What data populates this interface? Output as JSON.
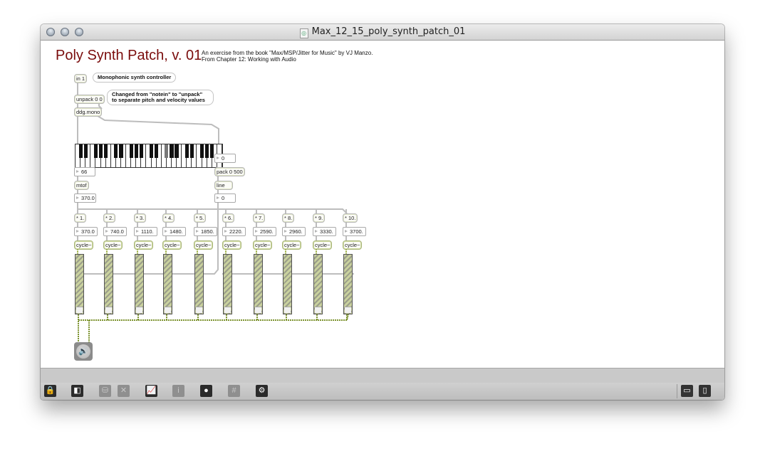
{
  "window": {
    "title": "Max_12_15_poly_synth_patch_01",
    "traffic_lights": [
      "close",
      "minimize",
      "zoom"
    ]
  },
  "patch": {
    "title": "Poly Synth Patch, v. 01",
    "description_line1": "An exercise from the book \"Max/MSP/Jitter for Music\" by VJ Manzo.",
    "description_line2": "From Chapter 12: Working with Audio"
  },
  "objects": {
    "in": "in 1",
    "in_comment": "Monophonic synth controller",
    "unpack": "unpack 0 0",
    "unpack_comment": "Changed from \"notein\" to \"unpack\" to separate pitch and velocity values",
    "ddg": "ddg.mono",
    "pitch_number": "66",
    "mtof": "mtof",
    "freq_number": "370.0",
    "vel_number": "0",
    "pack": "pack 0 500",
    "line": "line",
    "line_number": "0"
  },
  "keyboard": {
    "highlighted_key": "F#",
    "octaves": 5
  },
  "voices": [
    {
      "mult": "* 1.",
      "freq": "370.0",
      "osc": "cycle~"
    },
    {
      "mult": "* 2.",
      "freq": "740.0",
      "osc": "cycle~"
    },
    {
      "mult": "* 3.",
      "freq": "1110.",
      "osc": "cycle~"
    },
    {
      "mult": "* 4.",
      "freq": "1480.",
      "osc": "cycle~"
    },
    {
      "mult": "* 5.",
      "freq": "1850.",
      "osc": "cycle~"
    },
    {
      "mult": "* 6.",
      "freq": "2220.",
      "osc": "cycle~"
    },
    {
      "mult": "* 7.",
      "freq": "2590.",
      "osc": "cycle~"
    },
    {
      "mult": "* 8.",
      "freq": "2960.",
      "osc": "cycle~"
    },
    {
      "mult": "* 9.",
      "freq": "3330.",
      "osc": "cycle~"
    },
    {
      "mult": "* 10.",
      "freq": "3700.",
      "osc": "cycle~"
    }
  ],
  "gain_level": 0,
  "dac": {
    "icon": "speaker-icon"
  },
  "toolbar": {
    "items": [
      {
        "name": "lock",
        "glyph": "🔒",
        "enabled": true
      },
      {
        "name": "presentation",
        "glyph": "◧",
        "enabled": true
      },
      {
        "name": "paint-bucket",
        "glyph": "⛁",
        "enabled": false
      },
      {
        "name": "delete",
        "glyph": "✕",
        "enabled": false
      },
      {
        "name": "presentation-mode",
        "glyph": "📈",
        "enabled": true
      },
      {
        "name": "inspector",
        "glyph": "i",
        "enabled": false
      },
      {
        "name": "patch-cords",
        "glyph": "●",
        "enabled": true
      },
      {
        "name": "grid",
        "glyph": "#",
        "enabled": false
      },
      {
        "name": "audio-dsp",
        "glyph": "⚙",
        "enabled": true
      }
    ],
    "right_items": [
      {
        "name": "bottom-panel-toggle",
        "glyph": "▭"
      },
      {
        "name": "right-panel-toggle",
        "glyph": "▯"
      }
    ]
  }
}
